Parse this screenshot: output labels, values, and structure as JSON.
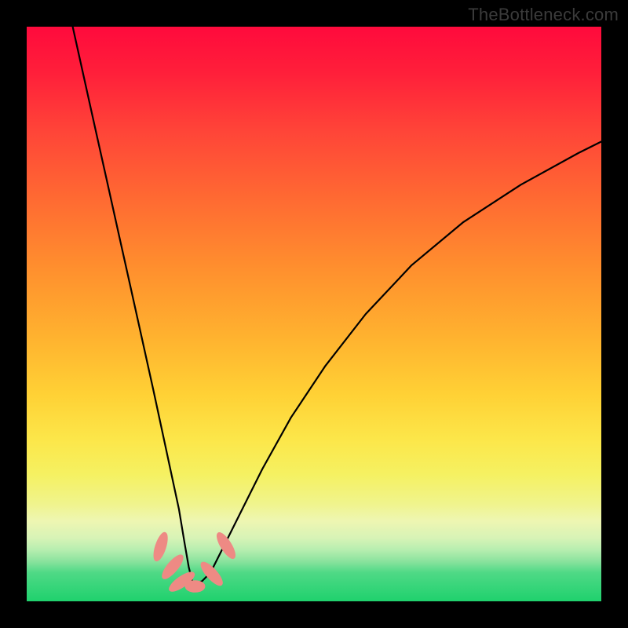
{
  "watermark": "TheBottleneck.com",
  "colors": {
    "frame": "#000000",
    "curve_stroke": "#000000",
    "marker_fill": "#ee8a84",
    "marker_stroke": "#ee8a84"
  },
  "chart_data": {
    "type": "line",
    "title": "",
    "xlabel": "",
    "ylabel": "",
    "xlim": [
      0,
      100
    ],
    "ylim": [
      0,
      100
    ],
    "grid": false,
    "legend": false,
    "annotations": [],
    "series": [
      {
        "name": "bottleneck-curve",
        "x": [
          8,
          10,
          12,
          14,
          16,
          18,
          20,
          22,
          23.5,
          25,
          26.5,
          27.5,
          28.2,
          28.8,
          29.5,
          30.5,
          32,
          34,
          37,
          41,
          46,
          52,
          59,
          67,
          76,
          86,
          96,
          100
        ],
        "y": [
          100,
          91,
          82,
          73,
          64,
          55,
          46,
          37,
          30,
          23,
          16,
          10,
          6,
          3.5,
          3.2,
          3.5,
          5,
          9,
          15,
          23,
          32,
          41,
          50,
          58.5,
          66,
          72.5,
          78,
          80
        ]
      }
    ],
    "markers": [
      {
        "x": 23.3,
        "y": 9.5,
        "rx": 0.9,
        "ry": 2.6,
        "rot": 18
      },
      {
        "x": 25.4,
        "y": 6.0,
        "rx": 0.9,
        "ry": 2.6,
        "rot": 40
      },
      {
        "x": 27.0,
        "y": 3.4,
        "rx": 0.9,
        "ry": 2.6,
        "rot": 55
      },
      {
        "x": 29.3,
        "y": 2.6,
        "rx": 1.7,
        "ry": 1.0,
        "rot": 0
      },
      {
        "x": 32.2,
        "y": 4.8,
        "rx": 0.9,
        "ry": 2.6,
        "rot": -42
      },
      {
        "x": 34.7,
        "y": 9.7,
        "rx": 0.9,
        "ry": 2.6,
        "rot": -32
      }
    ],
    "background_gradient_stops": [
      {
        "pos": 0.0,
        "color": "#ff0a3c"
      },
      {
        "pos": 0.3,
        "color": "#ff6a32"
      },
      {
        "pos": 0.64,
        "color": "#ffd135"
      },
      {
        "pos": 0.78,
        "color": "#f5f162"
      },
      {
        "pos": 0.9,
        "color": "#b7eeb0"
      },
      {
        "pos": 1.0,
        "color": "#1fd16d"
      }
    ]
  }
}
